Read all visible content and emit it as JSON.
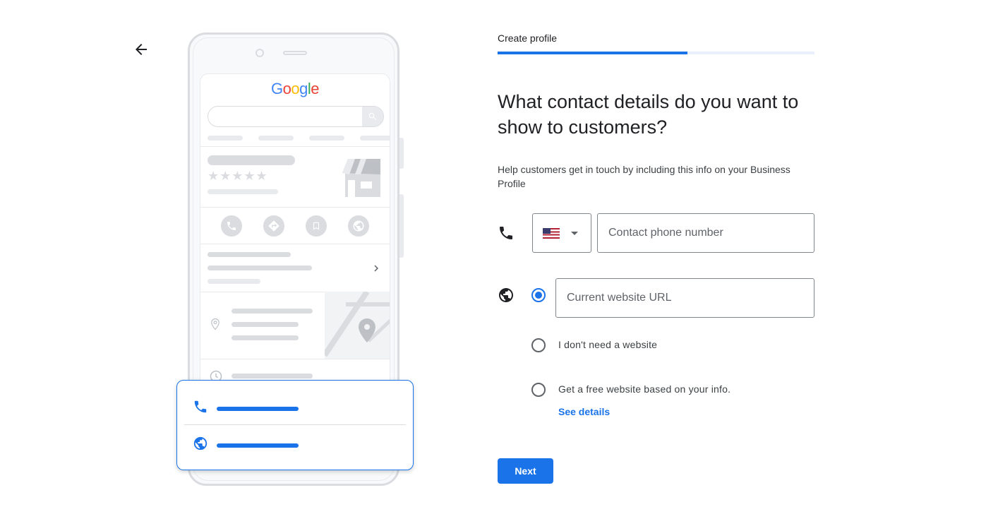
{
  "nav": {
    "back_icon": "arrow-back-icon"
  },
  "illustration": {
    "logo_letters": [
      {
        "char": "G",
        "color": "#4285f4"
      },
      {
        "char": "o",
        "color": "#ea4335"
      },
      {
        "char": "o",
        "color": "#fbbc05"
      },
      {
        "char": "g",
        "color": "#4285f4"
      },
      {
        "char": "l",
        "color": "#34a853"
      },
      {
        "char": "e",
        "color": "#ea4335"
      }
    ],
    "stars": "★★★★★",
    "action_icons": [
      "phone-icon",
      "directions-icon",
      "bookmark-icon",
      "globe-icon"
    ],
    "overlay_icons": [
      "phone-icon",
      "globe-icon"
    ]
  },
  "step": {
    "label": "Create profile",
    "progress_fraction": 0.6
  },
  "form": {
    "heading": "What contact details do you want to show to customers?",
    "subtext": "Help customers get in touch by including this info on your Business Profile",
    "phone": {
      "icon": "phone-icon",
      "country_flag": "us-flag-icon",
      "placeholder": "Contact phone number"
    },
    "website": {
      "icon": "globe-icon",
      "url_placeholder": "Current website URL",
      "options": [
        {
          "label": "I don't need a website",
          "checked": false
        },
        {
          "label": "Get a free website based on your info.",
          "checked": false
        }
      ],
      "see_details": "See details"
    },
    "next_label": "Next"
  },
  "colors": {
    "accent": "#1a73e8",
    "progress_track": "#e8f0fe",
    "border": "#80868b"
  }
}
